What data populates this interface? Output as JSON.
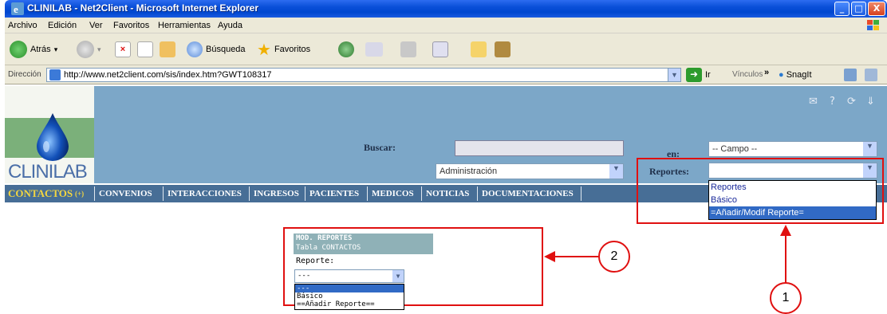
{
  "window": {
    "title": "CLINILAB - Net2Client - Microsoft Internet Explorer",
    "minimize": "_",
    "maximize": "□",
    "close": "X"
  },
  "menu": [
    "Archivo",
    "Edición",
    "Ver",
    "Favoritos",
    "Herramientas",
    "Ayuda"
  ],
  "toolbar": {
    "back": "Atrás",
    "search": "Búsqueda",
    "favorites": "Favoritos",
    "back_arrow": "▾",
    "fwd_arrow": "▾"
  },
  "address": {
    "label": "Dirección",
    "url": "http://www.net2client.com/sis/index.htm?GWT108317",
    "go": "Ir",
    "links": "Vínculos",
    "more": "»",
    "snagit": "SnagIt"
  },
  "page": {
    "logo_text": "CLINILAB",
    "buscar_label": "Buscar:",
    "en_label": "en:",
    "campo_value": "-- Campo --",
    "admin_value": "Administración",
    "reportes_label": "Reportes:",
    "reportes_value": "",
    "header_icons": [
      "✉",
      "?",
      "⟳",
      "⇓"
    ]
  },
  "nav": {
    "items": [
      "CONTACTOS",
      "CONVENIOS",
      "INTERACCIONES",
      "INGRESOS",
      "PACIENTES",
      "MEDICOS",
      "NOTICIAS",
      "DOCUMENTACIONES"
    ],
    "contactos_marker": "(+)"
  },
  "reportes_dropdown": {
    "options": [
      "Reportes",
      "Básico",
      "=Añadir/Modif Reporte="
    ],
    "selected_index": 2
  },
  "mod_panel": {
    "title": "MOD. REPORTES",
    "subtitle": "Tabla CONTACTOS",
    "field_label": "Reporte:",
    "select_value": "---",
    "options": [
      "---",
      "Básico",
      "==Añadir Reporte=="
    ],
    "selected_index": 0
  },
  "callouts": {
    "one": "1",
    "two": "2"
  },
  "colors": {
    "annotation_red": "#e01010",
    "selection_blue": "#316ac5",
    "nav_blue": "#476e96",
    "header_blue": "#7ca7c8"
  }
}
